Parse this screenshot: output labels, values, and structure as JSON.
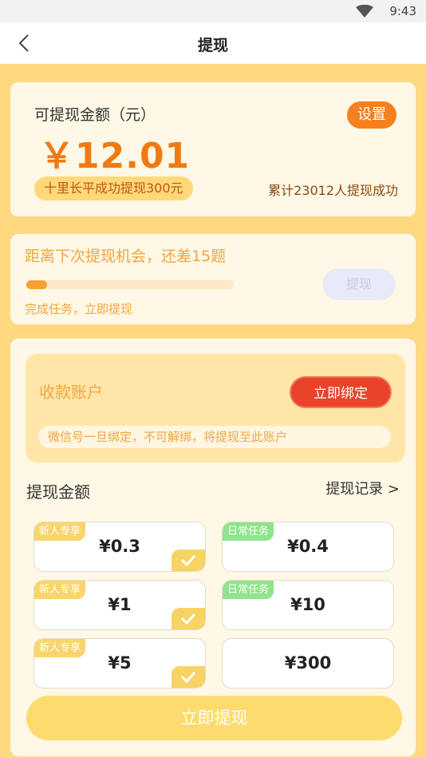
{
  "status_bar": {
    "time": "9:43",
    "wifi_icon": "wifi-icon"
  },
  "nav": {
    "title": "提现",
    "back_icon": "chevron-left-icon"
  },
  "balance": {
    "label": "可提现金额（元）",
    "value": "￥12.01",
    "settings_label": "设置",
    "notice": "十里长平成功提现300元",
    "total": "累计23012人提现成功"
  },
  "chance": {
    "title": "距离下次提现机会，还差15题",
    "progress": 0.1,
    "subtitle": "完成任务，立即提现",
    "button_label": "提现"
  },
  "account": {
    "title": "收款账户",
    "bind_label": "立即绑定",
    "note": "微信号一旦绑定，不可解绑，将提现至此账户"
  },
  "amount": {
    "title": "提现金额",
    "record_link": "提现记录 >",
    "options": [
      {
        "tag": "新人专享",
        "tag_color": "#f9d56e",
        "amount": "¥0.3",
        "checked": true
      },
      {
        "tag": "日常任务",
        "tag_color": "#8fe48c",
        "amount": "¥0.4",
        "checked": false
      },
      {
        "tag": "新人专享",
        "tag_color": "#f9d56e",
        "amount": "¥1",
        "checked": true
      },
      {
        "tag": "日常任务",
        "tag_color": "#8fe48c",
        "amount": "¥10",
        "checked": false
      },
      {
        "tag": "新人专享",
        "tag_color": "#f9d56e",
        "amount": "¥5",
        "checked": true
      },
      {
        "tag": "",
        "tag_color": "",
        "amount": "¥300",
        "checked": false
      }
    ]
  },
  "submit_label": "立即提现",
  "colors": {
    "accent": "#f5801f",
    "bind": "#e9432a",
    "background": "#ffd87f"
  }
}
